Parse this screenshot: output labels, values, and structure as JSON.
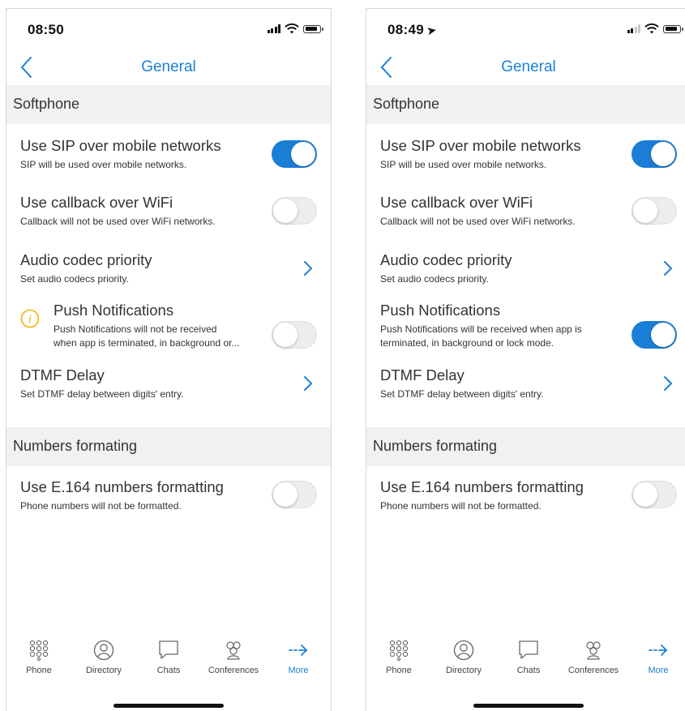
{
  "accent": "#1b7ed6",
  "screens": [
    {
      "time": "08:50",
      "show_location_arrow": false,
      "title": "General",
      "section_softphone": "Softphone",
      "rows": [
        {
          "title": "Use SIP over mobile networks",
          "subtitle": "SIP will be used over mobile networks.",
          "control": "toggle",
          "on": true
        },
        {
          "title": "Use callback over WiFi",
          "subtitle": "Callback will not be used over WiFi networks.",
          "control": "toggle",
          "on": false
        },
        {
          "title": "Audio codec priority",
          "subtitle": "Set audio codecs priority.",
          "control": "chevron"
        },
        {
          "title": "Push Notifications",
          "subtitle": "Push Notifications will not be received",
          "subtitle2": "when app is terminated, in background or...",
          "control": "toggle",
          "on": false,
          "warning_icon": true
        },
        {
          "title": "DTMF Delay",
          "subtitle": "Set DTMF delay between digits' entry.",
          "control": "chevron"
        }
      ],
      "section_numbers": "Numbers formating",
      "numbers_row": {
        "title": "Use E.164 numbers formatting",
        "subtitle": "Phone numbers will not be formatted.",
        "control": "toggle",
        "on": false
      }
    },
    {
      "time": "08:49",
      "show_location_arrow": true,
      "title": "General",
      "section_softphone": "Softphone",
      "rows": [
        {
          "title": "Use SIP over mobile networks",
          "subtitle": "SIP will be used over mobile networks.",
          "control": "toggle",
          "on": true
        },
        {
          "title": "Use callback over WiFi",
          "subtitle": "Callback will not be used over WiFi networks.",
          "control": "toggle",
          "on": false
        },
        {
          "title": "Audio codec priority",
          "subtitle": "Set audio codecs priority.",
          "control": "chevron"
        },
        {
          "title": "Push Notifications",
          "subtitle": "Push Notifications will be received when app is",
          "subtitle2": "terminated, in background or lock mode.",
          "control": "toggle",
          "on": true,
          "warning_icon": false
        },
        {
          "title": "DTMF Delay",
          "subtitle": "Set DTMF delay between digits' entry.",
          "control": "chevron"
        }
      ],
      "section_numbers": "Numbers formating",
      "numbers_row": {
        "title": "Use E.164 numbers formatting",
        "subtitle": "Phone numbers will not be formatted.",
        "control": "toggle",
        "on": false
      }
    }
  ],
  "tabs": [
    {
      "label": "Phone",
      "icon": "dialpad-icon",
      "active": false
    },
    {
      "label": "Directory",
      "icon": "contact-icon",
      "active": false
    },
    {
      "label": "Chats",
      "icon": "chat-bubble-icon",
      "active": false
    },
    {
      "label": "Conferences",
      "icon": "group-icon",
      "active": false
    },
    {
      "label": "More",
      "icon": "arrow-right-icon",
      "active": true
    }
  ]
}
